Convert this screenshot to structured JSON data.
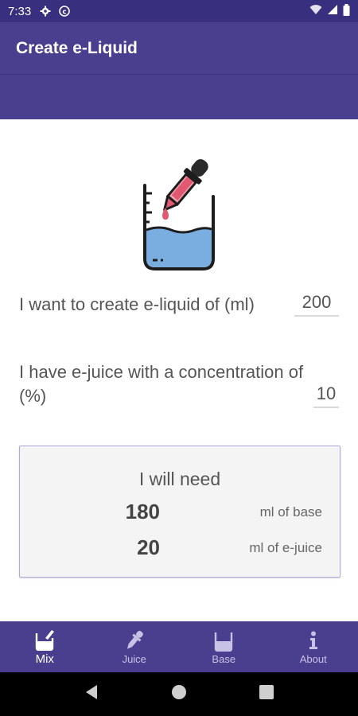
{
  "status_bar": {
    "time": "7:33"
  },
  "app_bar": {
    "title": "Create e-Liquid"
  },
  "form": {
    "volume_label": "I want to create e-liquid of (ml)",
    "volume_value": "200",
    "concentration_label": "I have e-juice with a concentration of (%)",
    "concentration_value": "10"
  },
  "result": {
    "title": "I will need",
    "base_amount": "180",
    "base_unit": "ml of base",
    "ejuice_amount": "20",
    "ejuice_unit": "ml of e-juice"
  },
  "bottom_nav": {
    "items": [
      {
        "label": "Mix",
        "icon": "mix-icon",
        "active": true
      },
      {
        "label": "Juice",
        "icon": "dropper-icon",
        "active": false
      },
      {
        "label": "Base",
        "icon": "beaker-icon",
        "active": false
      },
      {
        "label": "About",
        "icon": "info-icon",
        "active": false
      }
    ]
  },
  "colors": {
    "primary": "#4a3f8f",
    "status_bar": "#382f7f",
    "card_border": "#b0a8d8",
    "liquid": "#7aaee0"
  },
  "icons": {
    "status": [
      "gear-icon",
      "sync-icon",
      "wifi-icon",
      "signal-icon",
      "battery-icon"
    ],
    "system_nav": [
      "back-icon",
      "home-icon",
      "recents-icon"
    ]
  }
}
